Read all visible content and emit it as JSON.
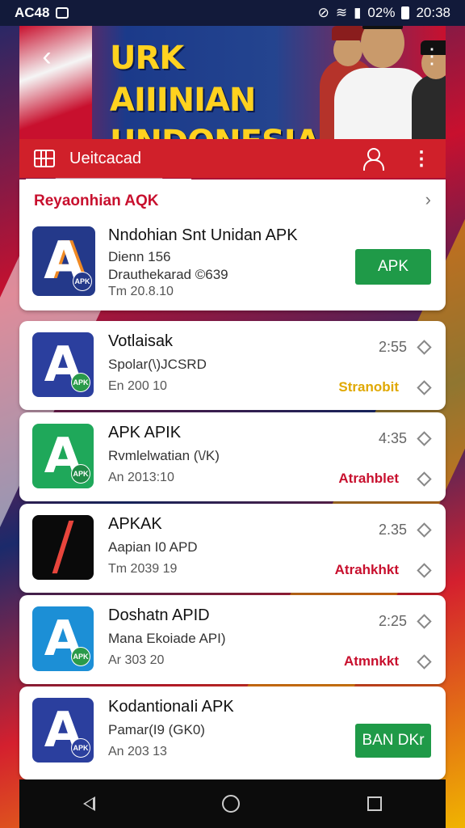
{
  "status_bar": {
    "time_left": "AC48",
    "battery": "02%",
    "time_right": "20:38"
  },
  "banner": {
    "title": "URK AIIINIAN UNDONESIA"
  },
  "toolbar": {
    "label": "Ueitcacad"
  },
  "featured": {
    "heading": "Reyaonhian AQK",
    "app": {
      "name": "Nndohian Snt Unidan APK",
      "line1": "Dienn 156",
      "line2": "Drauthekarad ©639",
      "date": "Tm 20.8.10",
      "button": "APK"
    }
  },
  "apps": [
    {
      "name": "Votlaisak",
      "sub": "Spolar(\\)JCSRD",
      "date": "En 200 10",
      "size": "2:55",
      "status": "Stranobit",
      "status_color": "#e0a800",
      "icon_bg": "#2b3f9e",
      "icon_fg": "#ffffff",
      "badge": "APK",
      "badge_bg": "#2a9a4a"
    },
    {
      "name": "APK APIK",
      "sub": "Rvmlelwatian (\\/K)",
      "date": "An 2013:10",
      "size": "4:35",
      "status": "Atrahblet",
      "status_color": "#c8102e",
      "icon_bg": "#1fa85a",
      "icon_fg": "#ffffff",
      "badge": "APK",
      "badge_bg": "#1f8a46"
    },
    {
      "name": "APKAK",
      "sub": "Aapian I0 APD",
      "date": "Tm 2039 19",
      "size": "2.35",
      "status": "Atrahkhkt",
      "status_color": "#c8102e",
      "icon_bg": "#0a0a0a",
      "icon_fg": "#e8453c",
      "badge": "",
      "badge_bg": ""
    },
    {
      "name": "Doshatn APID",
      "sub": "Mana Ekoiade API)",
      "date": "Ar 303 20",
      "size": "2:25",
      "status": "Atmnkkt",
      "status_color": "#c8102e",
      "icon_bg": "#1c8fd6",
      "icon_fg": "#ffffff",
      "badge": "APK",
      "badge_bg": "#2a9a4a"
    },
    {
      "name": "KodantionaIi APK",
      "sub": "Pamar(I9 (GK0)",
      "date": "An 203 13",
      "size": "",
      "status": "",
      "status_color": "#c8102e",
      "icon_bg": "#2b3f9e",
      "icon_fg": "#ffffff",
      "badge": "APK",
      "badge_bg": "#2b3f9e",
      "button": "BAN DKr"
    }
  ]
}
